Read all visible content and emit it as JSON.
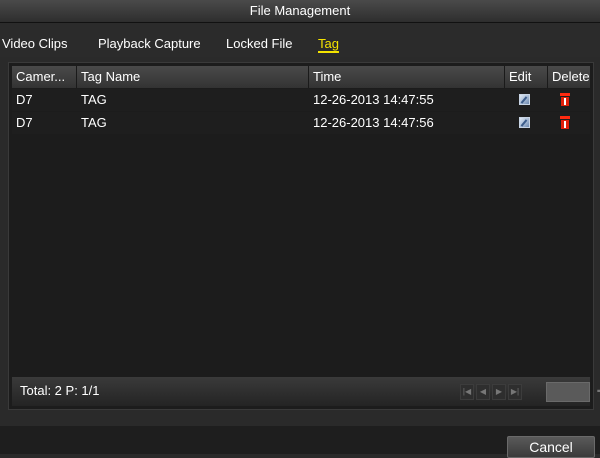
{
  "window": {
    "title": "File Management"
  },
  "tabs": [
    {
      "label": "Video Clips",
      "active": false
    },
    {
      "label": "Playback Capture",
      "active": false
    },
    {
      "label": "Locked File",
      "active": false
    },
    {
      "label": "Tag",
      "active": true
    }
  ],
  "table": {
    "columns": [
      "Camer...",
      "Tag Name",
      "Time",
      "Edit",
      "Delete"
    ],
    "rows": [
      {
        "camera": "D7",
        "tag_name": "TAG",
        "time": "12-26-2013 14:47:55",
        "edit_icon": "edit-icon",
        "delete_icon": "trash-icon"
      },
      {
        "camera": "D7",
        "tag_name": "TAG",
        "time": "12-26-2013 14:47:56",
        "edit_icon": "edit-icon",
        "delete_icon": "trash-icon"
      }
    ]
  },
  "footer": {
    "total_text": "Total: 2 P: 1/1",
    "pager_icons": [
      "first-page-icon",
      "prev-page-icon",
      "next-page-icon",
      "last-page-icon",
      "go-icon"
    ]
  },
  "buttons": {
    "cancel": "Cancel"
  },
  "colors": {
    "active_tab": "#f5e400",
    "delete_icon": "#e0200a",
    "background": "#2a2a2a"
  }
}
